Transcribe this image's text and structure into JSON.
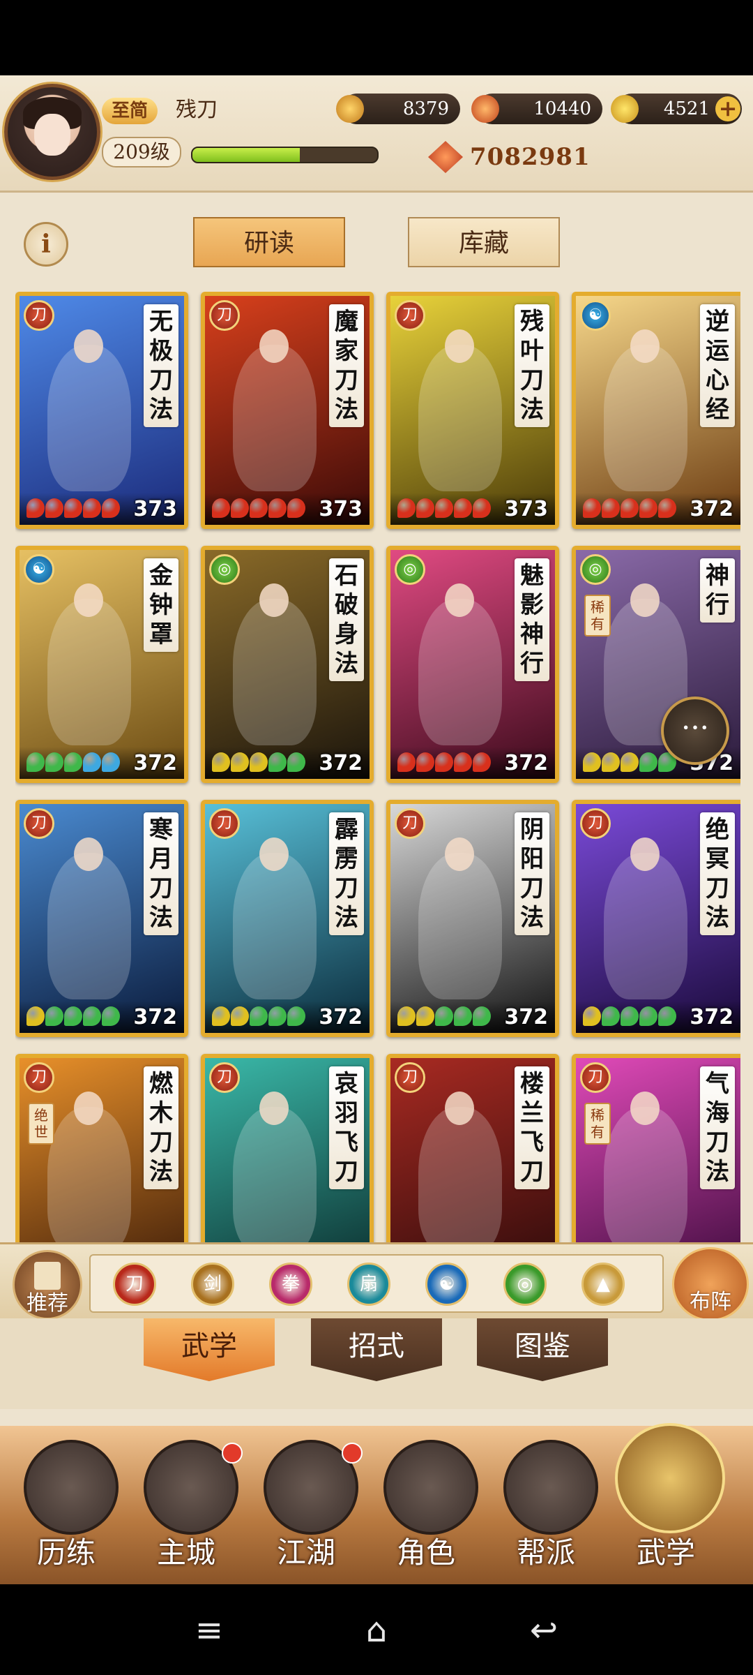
{
  "player": {
    "vip_label": "至简",
    "name": "残刀",
    "level": "209级",
    "xp_fraction": 0.58,
    "power": "7082981"
  },
  "currencies": [
    {
      "name": "coin",
      "value": "8379",
      "icon": "coin-icon",
      "color": "#d99a2a"
    },
    {
      "name": "ingot",
      "value": "10440",
      "icon": "flame-ingot-icon",
      "color": "#e0772a"
    },
    {
      "name": "gold",
      "value": "4521",
      "icon": "gold-ingot-icon",
      "color": "#f0c040"
    }
  ],
  "top_tabs": [
    {
      "label": "研读",
      "active": true
    },
    {
      "label": "库藏",
      "active": false
    }
  ],
  "cards": [
    {
      "title": "无极刀法",
      "level": "373",
      "badge": "red",
      "badge_icon": "sword-icon",
      "dots": [
        "#d8301c",
        "#d8301c",
        "#d8301c",
        "#d8301c",
        "#d8301c"
      ],
      "bg": [
        "#1b2a7a",
        "#4f8ae8"
      ]
    },
    {
      "title": "魔家刀法",
      "level": "373",
      "badge": "red",
      "badge_icon": "sword-icon",
      "dots": [
        "#d8301c",
        "#d8301c",
        "#d8301c",
        "#d8301c",
        "#d8301c"
      ],
      "bg": [
        "#3a0a08",
        "#d8401c"
      ]
    },
    {
      "title": "残叶刀法",
      "level": "373",
      "badge": "red",
      "badge_icon": "sword-icon",
      "dots": [
        "#d8301c",
        "#d8301c",
        "#d8301c",
        "#d8301c",
        "#d8301c"
      ],
      "bg": [
        "#4a3a08",
        "#e8d23a"
      ]
    },
    {
      "title": "逆运心经",
      "level": "372",
      "badge": "blue",
      "badge_icon": "yin-yang-icon",
      "dots": [
        "#d8301c",
        "#d8301c",
        "#d8301c",
        "#d8301c",
        "#d8301c"
      ],
      "bg": [
        "#6a3a10",
        "#f6d78a"
      ]
    },
    {
      "title": "金钟罩",
      "level": "372",
      "badge": "blue",
      "badge_icon": "yin-yang-icon",
      "dots": [
        "#3fb84a",
        "#3fb84a",
        "#3fb84a",
        "#3ea8e0",
        "#3ea8e0"
      ],
      "bg": [
        "#6a4a12",
        "#e6c063"
      ]
    },
    {
      "title": "石破身法",
      "level": "372",
      "badge": "green",
      "badge_icon": "swirl-icon",
      "dots": [
        "#e0c020",
        "#e0c020",
        "#e0c020",
        "#3fb84a",
        "#3fb84a"
      ],
      "bg": [
        "#1a140c",
        "#8a6a28"
      ]
    },
    {
      "title": "魅影神行",
      "level": "372",
      "badge": "green",
      "badge_icon": "swirl-icon",
      "dots": [
        "#d8301c",
        "#d8301c",
        "#d8301c",
        "#d8301c",
        "#d8301c"
      ],
      "bg": [
        "#3a0a1a",
        "#e04a82"
      ]
    },
    {
      "title": "神行",
      "rare": "稀有",
      "level": "372",
      "badge": "green",
      "badge_icon": "swirl-icon",
      "dots": [
        "#e0c020",
        "#e0c020",
        "#e0c020",
        "#3fb84a",
        "#3fb84a"
      ],
      "bg": [
        "#2a1a3a",
        "#8a6aa8"
      ]
    },
    {
      "title": "寒月刀法",
      "level": "372",
      "badge": "red",
      "badge_icon": "sword-icon",
      "dots": [
        "#e0c020",
        "#3fb84a",
        "#3fb84a",
        "#3fb84a",
        "#3fb84a"
      ],
      "bg": [
        "#0a1a3a",
        "#4a8ad0"
      ]
    },
    {
      "title": "霹雳刀法",
      "level": "372",
      "badge": "red",
      "badge_icon": "sword-icon",
      "dots": [
        "#e0c020",
        "#e0c020",
        "#3fb84a",
        "#3fb84a",
        "#3fb84a"
      ],
      "bg": [
        "#0a2a3a",
        "#58c0d8"
      ]
    },
    {
      "title": "阴阳刀法",
      "level": "372",
      "badge": "red",
      "badge_icon": "sword-icon",
      "dots": [
        "#e0c020",
        "#e0c020",
        "#3fb84a",
        "#3fb84a",
        "#3fb84a"
      ],
      "bg": [
        "#101010",
        "#d8d8d8"
      ]
    },
    {
      "title": "绝冥刀法",
      "level": "372",
      "badge": "red",
      "badge_icon": "sword-icon",
      "dots": [
        "#e0c020",
        "#3fb84a",
        "#3fb84a",
        "#3fb84a",
        "#3fb84a"
      ],
      "bg": [
        "#1a0a3a",
        "#7a4ad8"
      ]
    },
    {
      "title": "燃木刀法",
      "rare": "绝世",
      "level": "",
      "badge": "red",
      "badge_icon": "sword-icon",
      "dots": [],
      "bg": [
        "#3a1a08",
        "#e8902a"
      ]
    },
    {
      "title": "哀羽飞刀",
      "level": "",
      "badge": "red",
      "badge_icon": "sword-icon",
      "dots": [],
      "bg": [
        "#0a2a2a",
        "#3ab8a8"
      ]
    },
    {
      "title": "楼兰飞刀",
      "level": "",
      "badge": "red",
      "badge_icon": "sword-icon",
      "dots": [],
      "bg": [
        "#2a0a0a",
        "#a82a22"
      ]
    },
    {
      "title": "气海刀法",
      "rare": "稀有",
      "level": "",
      "badge": "red",
      "badge_icon": "sword-icon",
      "dots": [],
      "bg": [
        "#3a0a3a",
        "#e04ab8"
      ]
    }
  ],
  "filter": {
    "recommend_label": "推荐",
    "formation_label": "布阵",
    "icons": [
      {
        "name": "sword-filter-icon",
        "color": "#b8281a",
        "glyph": "刀"
      },
      {
        "name": "staff-filter-icon",
        "color": "#a8701e",
        "glyph": "剑"
      },
      {
        "name": "fist-filter-icon",
        "color": "#b82a6a",
        "glyph": "拳"
      },
      {
        "name": "fan-filter-icon",
        "color": "#1a8a9a",
        "glyph": "扇"
      },
      {
        "name": "yin-yang-filter-icon",
        "color": "#1a6ab8",
        "glyph": "☯"
      },
      {
        "name": "swirl-filter-icon",
        "color": "#3a9a2a",
        "glyph": "◎"
      },
      {
        "name": "up-arrow-filter-icon",
        "color": "#c89a3a",
        "glyph": "▲"
      }
    ]
  },
  "sub_tabs": [
    {
      "label": "武学",
      "active": true
    },
    {
      "label": "招式",
      "active": false
    },
    {
      "label": "图鉴",
      "active": false
    }
  ],
  "bottom_nav": [
    {
      "label": "历练",
      "icon": "training-icon",
      "alert": false,
      "active": false
    },
    {
      "label": "主城",
      "icon": "city-icon",
      "alert": true,
      "active": false
    },
    {
      "label": "江湖",
      "icon": "jianghu-icon",
      "alert": true,
      "active": false
    },
    {
      "label": "角色",
      "icon": "character-icon",
      "alert": false,
      "active": false
    },
    {
      "label": "帮派",
      "icon": "guild-icon",
      "alert": false,
      "active": false
    },
    {
      "label": "武学",
      "icon": "martial-arts-icon",
      "alert": false,
      "active": true
    }
  ]
}
